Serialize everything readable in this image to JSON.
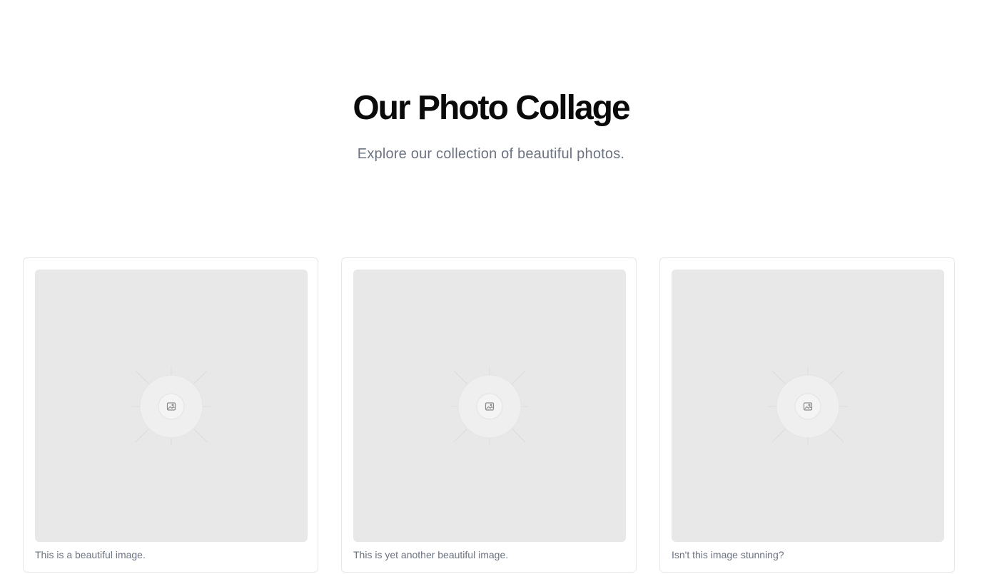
{
  "header": {
    "title": "Our Photo Collage",
    "subtitle": "Explore our collection of beautiful photos."
  },
  "gallery": {
    "items": [
      {
        "caption": "This is a beautiful image.",
        "icon": "image-placeholder-icon"
      },
      {
        "caption": "This is yet another beautiful image.",
        "icon": "image-placeholder-icon"
      },
      {
        "caption": "Isn't this image stunning?",
        "icon": "image-placeholder-icon"
      }
    ]
  },
  "colors": {
    "title": "#0a0a0a",
    "subtitle": "#6b7280",
    "card_border": "#e5e7eb",
    "photo_bg": "#e8e8e8"
  }
}
